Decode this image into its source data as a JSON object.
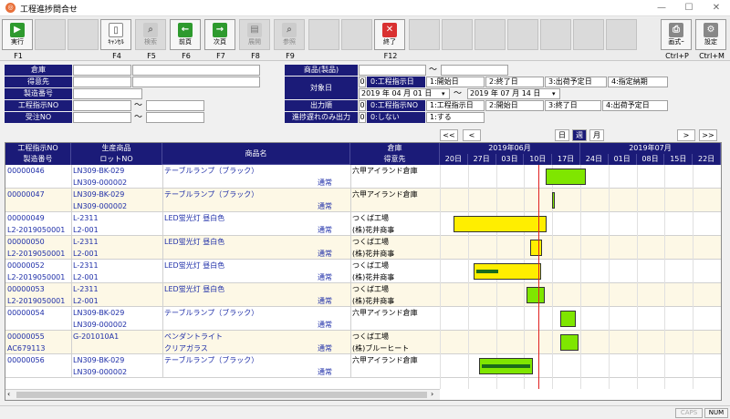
{
  "window": {
    "title": "工程進捗問合せ"
  },
  "toolbar": {
    "buttons": [
      {
        "label": "実行",
        "fkey": "F1"
      },
      {
        "label": "ｷｬﾝｾﾙ",
        "fkey": "F4"
      },
      {
        "label": "検索",
        "fkey": "F5"
      },
      {
        "label": "前頁",
        "fkey": "F6"
      },
      {
        "label": "次頁",
        "fkey": "F7"
      },
      {
        "label": "展開",
        "fkey": "F8"
      },
      {
        "label": "参照",
        "fkey": "F9"
      },
      {
        "label": "終了",
        "fkey": "F12"
      },
      {
        "label": "画式ｰ",
        "fkey": "Ctrl+P"
      },
      {
        "label": "設定",
        "fkey": "Ctrl+M"
      }
    ]
  },
  "filters": {
    "left": [
      {
        "label": "倉庫",
        "value": ""
      },
      {
        "label": "得意先",
        "value": ""
      },
      {
        "label": "製造番号",
        "value": ""
      },
      {
        "label": "工程指示NO",
        "value": ""
      },
      {
        "label": "受注NO",
        "value": ""
      }
    ],
    "tilde": "〜",
    "product_label": "商品(製品)",
    "target_date_label": "対象日",
    "target_date_num": "0",
    "target_date_options": [
      "0:工程指示日",
      "1:開始日",
      "2:終了日",
      "3:出荷予定日",
      "4:指定納期"
    ],
    "date_from": "2019 年 04 月 01 日",
    "date_to": "2019 年 07 月 14 日",
    "output_order_label": "出力順",
    "output_order_num": "0",
    "output_order_options": [
      "0:工程指示NO",
      "1:工程指示日",
      "2:開始日",
      "3:終了日",
      "4:出荷予定日"
    ],
    "delay_label": "進捗遅れのみ出力",
    "delay_num": "0",
    "delay_options": [
      "0:しない",
      "1:する"
    ]
  },
  "view": {
    "nav_buttons": [
      "<<",
      "<",
      ">",
      ">>"
    ],
    "tabs": [
      "日",
      "週",
      "月"
    ],
    "selected_tab": "週"
  },
  "table": {
    "headers": {
      "col1_top": "工程指示NO",
      "col1_bot": "製造番号",
      "col2_top": "生産商品",
      "col2_bot": "ロットNO",
      "col3": "商品名",
      "col4_top": "倉庫",
      "col4_bot": "得意先"
    },
    "records": [
      {
        "order": "00000046",
        "prod": "LN309-BK-029",
        "name": "テーブルランプ（ブラック）",
        "wh": "六甲アイランド倉庫",
        "mfg": "",
        "lot": "LN309-000002",
        "type": "通常",
        "cust": ""
      },
      {
        "order": "00000047",
        "prod": "LN309-BK-029",
        "name": "テーブルランプ（ブラック）",
        "wh": "六甲アイランド倉庫",
        "mfg": "",
        "lot": "LN309-000002",
        "type": "通常",
        "cust": ""
      },
      {
        "order": "00000049",
        "prod": "L-2311",
        "name": "LED蛍光灯 昼白色",
        "wh": "つくば工場",
        "mfg": "L2-2019050001",
        "lot": "L2-001",
        "type": "通常",
        "cust": "(株)花井商事"
      },
      {
        "order": "00000050",
        "prod": "L-2311",
        "name": "LED蛍光灯 昼白色",
        "wh": "つくば工場",
        "mfg": "L2-2019050001",
        "lot": "L2-001",
        "type": "通常",
        "cust": "(株)花井商事"
      },
      {
        "order": "00000052",
        "prod": "L-2311",
        "name": "LED蛍光灯 昼白色",
        "wh": "つくば工場",
        "mfg": "L2-2019050001",
        "lot": "L2-001",
        "type": "通常",
        "cust": "(株)花井商事"
      },
      {
        "order": "00000053",
        "prod": "L-2311",
        "name": "LED蛍光灯 昼白色",
        "wh": "つくば工場",
        "mfg": "L2-2019050001",
        "lot": "L2-001",
        "type": "通常",
        "cust": "(株)花井商事"
      },
      {
        "order": "00000054",
        "prod": "LN309-BK-029",
        "name": "テーブルランプ（ブラック）",
        "wh": "六甲アイランド倉庫",
        "mfg": "",
        "lot": "LN309-000002",
        "type": "通常",
        "cust": ""
      },
      {
        "order": "00000055",
        "prod": "G-201010A1",
        "name": "ペンダントライト",
        "wh": "つくば工場",
        "mfg": "AC679113",
        "lot": "",
        "type": "通常",
        "cust": "(株)ブルーヒート",
        "name2": "クリアガラス"
      },
      {
        "order": "00000056",
        "prod": "LN309-BK-029",
        "name": "テーブルランプ（ブラック）",
        "wh": "六甲アイランド倉庫",
        "mfg": "",
        "lot": "LN309-000002",
        "type": "通常",
        "cust": ""
      }
    ]
  },
  "gantt": {
    "months": [
      "2019年06月",
      "2019年07月"
    ],
    "weeks": [
      "20日",
      "27日",
      "03日",
      "10日",
      "17日",
      "24日",
      "01日",
      "08日",
      "15日",
      "22日"
    ],
    "bars": [
      {
        "row": 0,
        "start": 3.75,
        "end": 5.2,
        "color": "#7fe600",
        "progress": 0
      },
      {
        "row": 1,
        "start": 4.0,
        "end": 4.08,
        "color": "#7fe600",
        "progress": 0
      },
      {
        "row": 2,
        "start": 0.5,
        "end": 3.8,
        "color": "#ffee00",
        "progress": 0
      },
      {
        "row": 3,
        "start": 3.2,
        "end": 3.65,
        "color": "#ffee00",
        "progress": 0
      },
      {
        "row": 4,
        "start": 1.2,
        "end": 3.6,
        "color": "#ffee00",
        "progress": 0.35
      },
      {
        "row": 5,
        "start": 3.1,
        "end": 3.75,
        "color": "#7fe600",
        "progress": 0
      },
      {
        "row": 6,
        "start": 4.3,
        "end": 4.85,
        "color": "#7fe600",
        "progress": 0
      },
      {
        "row": 7,
        "start": 4.3,
        "end": 4.95,
        "color": "#7fe600",
        "progress": 0
      },
      {
        "row": 8,
        "start": 1.4,
        "end": 3.3,
        "color": "#7fe600",
        "progress": 1
      }
    ],
    "today": 3.5
  },
  "status": {
    "caps": "CAPS",
    "num": "NUM"
  }
}
